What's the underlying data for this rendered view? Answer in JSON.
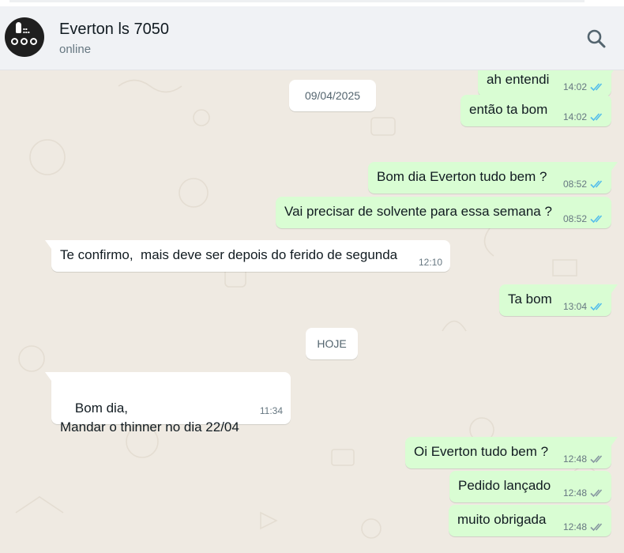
{
  "contact": {
    "name": "Everton ls 7050",
    "status": "online"
  },
  "colors": {
    "header_bg": "#f0f2f5",
    "chat_bg": "#efeae2",
    "outgoing_bubble": "#d9fdd3",
    "incoming_bubble": "#ffffff",
    "read_check": "#53bdeb",
    "delivered_check": "#8696a0"
  },
  "icons": {
    "search": "search-icon",
    "avatar": "company-logo-avatar",
    "read": "double-check-read-icon",
    "delivered": "double-check-delivered-icon"
  },
  "dates": {
    "first": "09/04/2025",
    "today": "HOJE"
  },
  "messages": [
    {
      "text": "ah entendi",
      "time": "14:02",
      "direction": "out",
      "status": "read"
    },
    {
      "text": "então ta bom",
      "time": "14:02",
      "direction": "out",
      "status": "read"
    },
    {
      "text": "Bom dia Everton tudo bem ?",
      "time": "08:52",
      "direction": "out",
      "status": "read"
    },
    {
      "text": "Vai precisar de solvente para essa semana ?",
      "time": "08:52",
      "direction": "out",
      "status": "read"
    },
    {
      "text": "Te confirmo,  mais deve ser depois do ferido de segunda",
      "time": "12:10",
      "direction": "in"
    },
    {
      "text": "Ta bom",
      "time": "13:04",
      "direction": "out",
      "status": "read"
    },
    {
      "text": "Bom dia,\nMandar o thinner no dia 22/04",
      "time": "11:34",
      "direction": "in"
    },
    {
      "text": "Oi Everton tudo bem ?",
      "time": "12:48",
      "direction": "out",
      "status": "delivered"
    },
    {
      "text": "Pedido lançado",
      "time": "12:48",
      "direction": "out",
      "status": "delivered"
    },
    {
      "text": "muito obrigada",
      "time": "12:48",
      "direction": "out",
      "status": "delivered"
    }
  ]
}
